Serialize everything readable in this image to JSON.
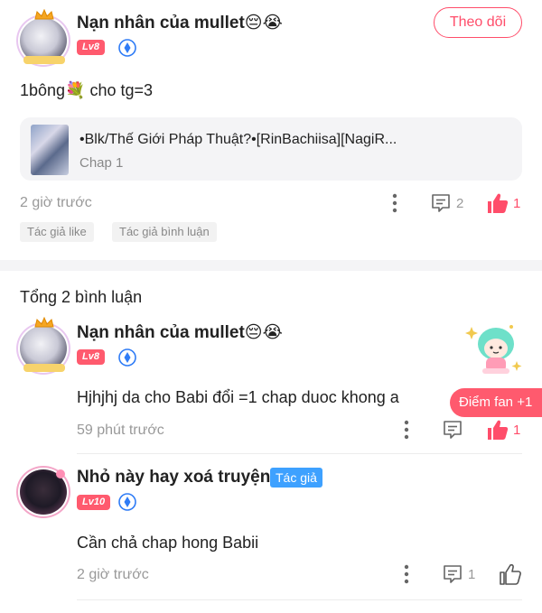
{
  "post": {
    "author_name": "Nạn nhân của mullet😔😭",
    "level": "Lv8",
    "follow_label": "Theo dõi",
    "text": "1bông💐 cho tg=3",
    "chapter": {
      "title": "•Blk/Thế Giới Pháp Thuật?•[RinBachiisa][NagiR...",
      "subtitle": "Chap 1"
    },
    "time": "2 giờ trước",
    "comment_count": "2",
    "like_count": "1",
    "tags": [
      "Tác giả like",
      "Tác giả bình luận"
    ]
  },
  "comments_section": {
    "total_label": "Tổng 2 bình luận",
    "fan_points_label": "Điểm fan +1",
    "comments": [
      {
        "author_name": "Nạn nhân của mullet😔😭",
        "level": "Lv8",
        "text": "Hjhjhj da cho Babi đổi =1 chap duoc khong a",
        "time": "59 phút trước",
        "like_count": "1"
      },
      {
        "author_name": "Nhỏ này hay xoá truyện",
        "author_badge": "Tác giả",
        "level": "Lv10",
        "text": "Cần chả chap hong Babii",
        "time": "2 giờ trước",
        "reply_count": "1"
      }
    ]
  },
  "colors": {
    "accent": "#ff4d6a",
    "level_badge": "#ff5a6e",
    "author_badge": "#3ea1ff",
    "verify_badge": "#2f7cf6",
    "muted_text": "#999999"
  },
  "icons": [
    "more-vertical-icon",
    "comment-icon",
    "thumbs-up-icon",
    "verified-icon",
    "sticker-mascot-icon"
  ]
}
